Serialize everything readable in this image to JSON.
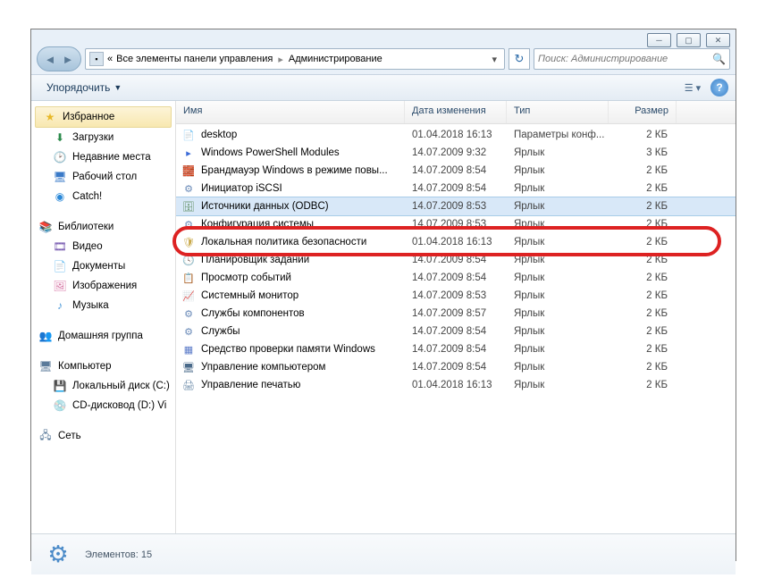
{
  "window": {
    "breadcrumb": {
      "prefix": "«",
      "part1": "Все элементы панели управления",
      "part2": "Администрирование"
    },
    "search_placeholder": "Поиск: Администрирование"
  },
  "toolbar": {
    "organize": "Упорядочить"
  },
  "sidebar": {
    "favorites": {
      "label": "Избранное",
      "items": [
        {
          "label": "Загрузки",
          "icon": "⬇",
          "color": "#2a8a4a"
        },
        {
          "label": "Недавние места",
          "icon": "🕑",
          "color": "#c88a2a"
        },
        {
          "label": "Рабочий стол",
          "icon": "🖥",
          "color": "#3a7ac8"
        },
        {
          "label": "Catch!",
          "icon": "◉",
          "color": "#2a88d8"
        }
      ]
    },
    "libraries": {
      "label": "Библиотеки",
      "items": [
        {
          "label": "Видео",
          "icon": "🎞",
          "color": "#6a4aa8"
        },
        {
          "label": "Документы",
          "icon": "📄",
          "color": "#c89850"
        },
        {
          "label": "Изображения",
          "icon": "🖼",
          "color": "#d87aa8"
        },
        {
          "label": "Музыка",
          "icon": "♪",
          "color": "#4a98d8"
        }
      ]
    },
    "homegroup": {
      "label": "Домашняя группа",
      "icon": "👥"
    },
    "computer": {
      "label": "Компьютер",
      "items": [
        {
          "label": "Локальный диск (C:)",
          "icon": "💾",
          "color": "#6a8aa8"
        },
        {
          "label": "CD-дисковод (D:) Vi",
          "icon": "💿",
          "color": "#8aa8c8"
        }
      ]
    },
    "network": {
      "label": "Сеть",
      "icon": "🖧"
    }
  },
  "columns": {
    "name": "Имя",
    "date": "Дата изменения",
    "type": "Тип",
    "size": "Размер"
  },
  "rows": [
    {
      "name": "desktop",
      "date": "01.04.2018 16:13",
      "type": "Параметры конф...",
      "size": "2 КБ",
      "icon": "📄",
      "color": "#b8b8b8"
    },
    {
      "name": "Windows PowerShell Modules",
      "date": "14.07.2009 9:32",
      "type": "Ярлык",
      "size": "3 КБ",
      "icon": "▸",
      "color": "#3a6ad8"
    },
    {
      "name": "Брандмауэр Windows в режиме повы...",
      "date": "14.07.2009 8:54",
      "type": "Ярлык",
      "size": "2 КБ",
      "icon": "🧱",
      "color": "#c85a3a"
    },
    {
      "name": "Инициатор iSCSI",
      "date": "14.07.2009 8:54",
      "type": "Ярлык",
      "size": "2 КБ",
      "icon": "⚙",
      "color": "#6a8ab8"
    },
    {
      "name": "Источники данных (ODBC)",
      "date": "14.07.2009 8:53",
      "type": "Ярлык",
      "size": "2 КБ",
      "icon": "🗄",
      "color": "#5a8a5a",
      "selected": true
    },
    {
      "name": "Конфигурация системы",
      "date": "14.07.2009 8:53",
      "type": "Ярлык",
      "size": "2 КБ",
      "icon": "⚙",
      "color": "#6a8ab8"
    },
    {
      "name": "Локальная политика безопасности",
      "date": "01.04.2018 16:13",
      "type": "Ярлык",
      "size": "2 КБ",
      "icon": "🛡",
      "color": "#c8a848",
      "highlight": true
    },
    {
      "name": "Планировщик заданий",
      "date": "14.07.2009 8:54",
      "type": "Ярлык",
      "size": "2 КБ",
      "icon": "🕓",
      "color": "#8a6ac8"
    },
    {
      "name": "Просмотр событий",
      "date": "14.07.2009 8:54",
      "type": "Ярлык",
      "size": "2 КБ",
      "icon": "📋",
      "color": "#7a5a3a"
    },
    {
      "name": "Системный монитор",
      "date": "14.07.2009 8:53",
      "type": "Ярлык",
      "size": "2 КБ",
      "icon": "📈",
      "color": "#4aa84a"
    },
    {
      "name": "Службы компонентов",
      "date": "14.07.2009 8:57",
      "type": "Ярлык",
      "size": "2 КБ",
      "icon": "⚙",
      "color": "#6a8ab8"
    },
    {
      "name": "Службы",
      "date": "14.07.2009 8:54",
      "type": "Ярлык",
      "size": "2 КБ",
      "icon": "⚙",
      "color": "#6a8ab8"
    },
    {
      "name": "Средство проверки памяти Windows",
      "date": "14.07.2009 8:54",
      "type": "Ярлык",
      "size": "2 КБ",
      "icon": "▦",
      "color": "#5a7ac8"
    },
    {
      "name": "Управление компьютером",
      "date": "14.07.2009 8:54",
      "type": "Ярлык",
      "size": "2 КБ",
      "icon": "🖥",
      "color": "#4a6a8a"
    },
    {
      "name": "Управление печатью",
      "date": "01.04.2018 16:13",
      "type": "Ярлык",
      "size": "2 КБ",
      "icon": "🖨",
      "color": "#6a8aa8"
    }
  ],
  "status": {
    "text": "Элементов: 15"
  }
}
